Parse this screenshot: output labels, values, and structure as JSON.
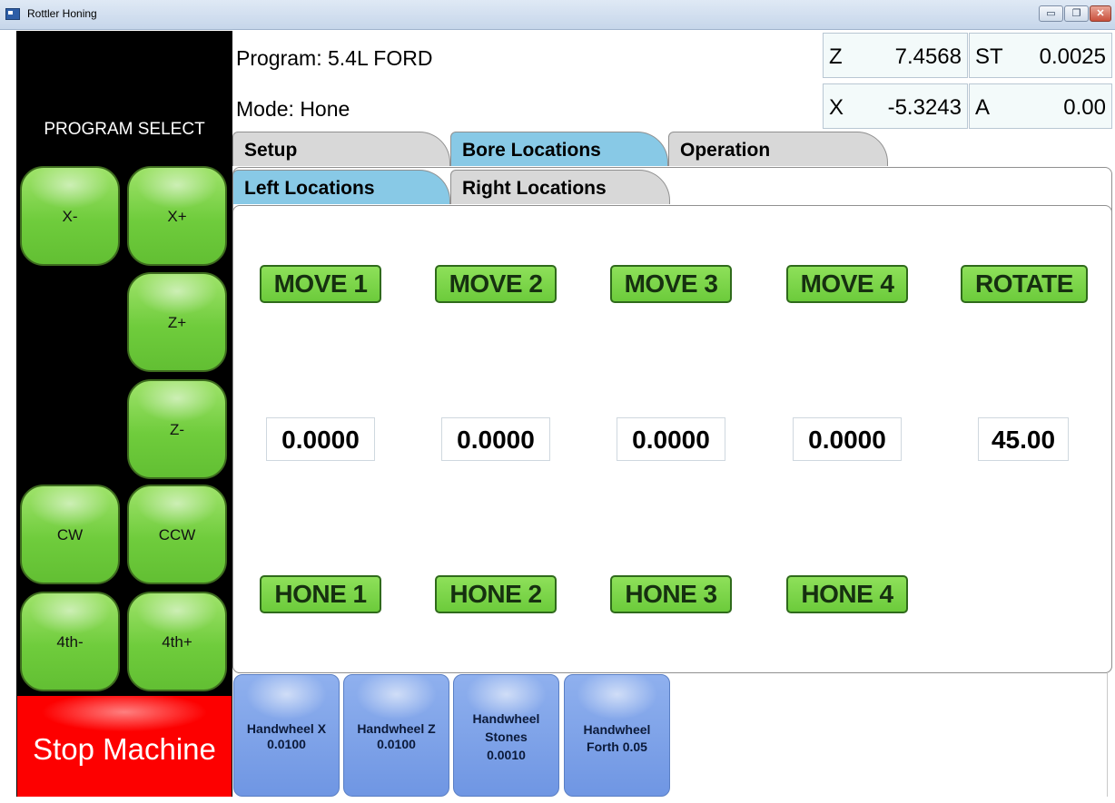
{
  "window": {
    "title": "Rottler Honing",
    "min_glyph": "▭",
    "max_glyph": "❐",
    "close_glyph": "✕"
  },
  "left_panel": {
    "heading": "PROGRAM SELECT",
    "jog_buttons": {
      "x_minus": "X-",
      "x_plus": "X+",
      "z_plus": "Z+",
      "z_minus": "Z-",
      "cw": "CW",
      "ccw": "CCW",
      "fourth_minus": "4th-",
      "fourth_plus": "4th+"
    },
    "stop": "Stop Machine"
  },
  "header": {
    "program": "Program: 5.4L FORD",
    "mode": "Mode: Hone",
    "readouts": {
      "z": {
        "label": "Z",
        "value": "7.4568"
      },
      "st": {
        "label": "ST",
        "value": "0.0025"
      },
      "x": {
        "label": "X",
        "value": "-5.3243"
      },
      "a": {
        "label": "A",
        "value": "0.00"
      }
    }
  },
  "tabs": {
    "setup": "Setup",
    "bore": "Bore Locations",
    "operation": "Operation"
  },
  "subtabs": {
    "left": "Left Locations",
    "right": "Right Locations"
  },
  "moves": [
    "MOVE 1",
    "MOVE 2",
    "MOVE 3",
    "MOVE 4",
    "ROTATE"
  ],
  "values": [
    "0.0000",
    "0.0000",
    "0.0000",
    "0.0000",
    "45.00"
  ],
  "hones": [
    "HONE 1",
    "HONE 2",
    "HONE 3",
    "HONE 4"
  ],
  "handwheels": [
    {
      "line1": "Handwheel X",
      "line2": "0.0100"
    },
    {
      "line1": "Handwheel Z",
      "line2": "0.0100"
    },
    {
      "line1": "Handwheel",
      "line2": "Stones",
      "line3": "0.0010"
    },
    {
      "line1": "Handwheel",
      "line2": "Forth 0.05"
    }
  ],
  "colors": {
    "jog_green": "#7ad44a",
    "stop_red": "#fd0000",
    "tab_active": "#88c9e6",
    "handwheel_blue": "#7ea3ea"
  }
}
